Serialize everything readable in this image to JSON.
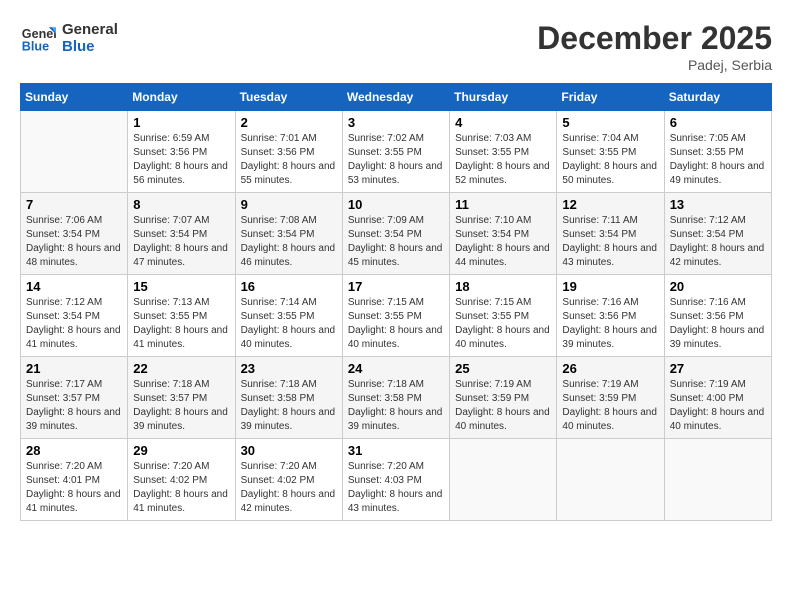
{
  "header": {
    "logo_line1": "General",
    "logo_line2": "Blue",
    "month": "December 2025",
    "location": "Padej, Serbia"
  },
  "weekdays": [
    "Sunday",
    "Monday",
    "Tuesday",
    "Wednesday",
    "Thursday",
    "Friday",
    "Saturday"
  ],
  "weeks": [
    [
      {
        "day": "",
        "sunrise": "",
        "sunset": "",
        "daylight": ""
      },
      {
        "day": "1",
        "sunrise": "Sunrise: 6:59 AM",
        "sunset": "Sunset: 3:56 PM",
        "daylight": "Daylight: 8 hours and 56 minutes."
      },
      {
        "day": "2",
        "sunrise": "Sunrise: 7:01 AM",
        "sunset": "Sunset: 3:56 PM",
        "daylight": "Daylight: 8 hours and 55 minutes."
      },
      {
        "day": "3",
        "sunrise": "Sunrise: 7:02 AM",
        "sunset": "Sunset: 3:55 PM",
        "daylight": "Daylight: 8 hours and 53 minutes."
      },
      {
        "day": "4",
        "sunrise": "Sunrise: 7:03 AM",
        "sunset": "Sunset: 3:55 PM",
        "daylight": "Daylight: 8 hours and 52 minutes."
      },
      {
        "day": "5",
        "sunrise": "Sunrise: 7:04 AM",
        "sunset": "Sunset: 3:55 PM",
        "daylight": "Daylight: 8 hours and 50 minutes."
      },
      {
        "day": "6",
        "sunrise": "Sunrise: 7:05 AM",
        "sunset": "Sunset: 3:55 PM",
        "daylight": "Daylight: 8 hours and 49 minutes."
      }
    ],
    [
      {
        "day": "7",
        "sunrise": "Sunrise: 7:06 AM",
        "sunset": "Sunset: 3:54 PM",
        "daylight": "Daylight: 8 hours and 48 minutes."
      },
      {
        "day": "8",
        "sunrise": "Sunrise: 7:07 AM",
        "sunset": "Sunset: 3:54 PM",
        "daylight": "Daylight: 8 hours and 47 minutes."
      },
      {
        "day": "9",
        "sunrise": "Sunrise: 7:08 AM",
        "sunset": "Sunset: 3:54 PM",
        "daylight": "Daylight: 8 hours and 46 minutes."
      },
      {
        "day": "10",
        "sunrise": "Sunrise: 7:09 AM",
        "sunset": "Sunset: 3:54 PM",
        "daylight": "Daylight: 8 hours and 45 minutes."
      },
      {
        "day": "11",
        "sunrise": "Sunrise: 7:10 AM",
        "sunset": "Sunset: 3:54 PM",
        "daylight": "Daylight: 8 hours and 44 minutes."
      },
      {
        "day": "12",
        "sunrise": "Sunrise: 7:11 AM",
        "sunset": "Sunset: 3:54 PM",
        "daylight": "Daylight: 8 hours and 43 minutes."
      },
      {
        "day": "13",
        "sunrise": "Sunrise: 7:12 AM",
        "sunset": "Sunset: 3:54 PM",
        "daylight": "Daylight: 8 hours and 42 minutes."
      }
    ],
    [
      {
        "day": "14",
        "sunrise": "Sunrise: 7:12 AM",
        "sunset": "Sunset: 3:54 PM",
        "daylight": "Daylight: 8 hours and 41 minutes."
      },
      {
        "day": "15",
        "sunrise": "Sunrise: 7:13 AM",
        "sunset": "Sunset: 3:55 PM",
        "daylight": "Daylight: 8 hours and 41 minutes."
      },
      {
        "day": "16",
        "sunrise": "Sunrise: 7:14 AM",
        "sunset": "Sunset: 3:55 PM",
        "daylight": "Daylight: 8 hours and 40 minutes."
      },
      {
        "day": "17",
        "sunrise": "Sunrise: 7:15 AM",
        "sunset": "Sunset: 3:55 PM",
        "daylight": "Daylight: 8 hours and 40 minutes."
      },
      {
        "day": "18",
        "sunrise": "Sunrise: 7:15 AM",
        "sunset": "Sunset: 3:55 PM",
        "daylight": "Daylight: 8 hours and 40 minutes."
      },
      {
        "day": "19",
        "sunrise": "Sunrise: 7:16 AM",
        "sunset": "Sunset: 3:56 PM",
        "daylight": "Daylight: 8 hours and 39 minutes."
      },
      {
        "day": "20",
        "sunrise": "Sunrise: 7:16 AM",
        "sunset": "Sunset: 3:56 PM",
        "daylight": "Daylight: 8 hours and 39 minutes."
      }
    ],
    [
      {
        "day": "21",
        "sunrise": "Sunrise: 7:17 AM",
        "sunset": "Sunset: 3:57 PM",
        "daylight": "Daylight: 8 hours and 39 minutes."
      },
      {
        "day": "22",
        "sunrise": "Sunrise: 7:18 AM",
        "sunset": "Sunset: 3:57 PM",
        "daylight": "Daylight: 8 hours and 39 minutes."
      },
      {
        "day": "23",
        "sunrise": "Sunrise: 7:18 AM",
        "sunset": "Sunset: 3:58 PM",
        "daylight": "Daylight: 8 hours and 39 minutes."
      },
      {
        "day": "24",
        "sunrise": "Sunrise: 7:18 AM",
        "sunset": "Sunset: 3:58 PM",
        "daylight": "Daylight: 8 hours and 39 minutes."
      },
      {
        "day": "25",
        "sunrise": "Sunrise: 7:19 AM",
        "sunset": "Sunset: 3:59 PM",
        "daylight": "Daylight: 8 hours and 40 minutes."
      },
      {
        "day": "26",
        "sunrise": "Sunrise: 7:19 AM",
        "sunset": "Sunset: 3:59 PM",
        "daylight": "Daylight: 8 hours and 40 minutes."
      },
      {
        "day": "27",
        "sunrise": "Sunrise: 7:19 AM",
        "sunset": "Sunset: 4:00 PM",
        "daylight": "Daylight: 8 hours and 40 minutes."
      }
    ],
    [
      {
        "day": "28",
        "sunrise": "Sunrise: 7:20 AM",
        "sunset": "Sunset: 4:01 PM",
        "daylight": "Daylight: 8 hours and 41 minutes."
      },
      {
        "day": "29",
        "sunrise": "Sunrise: 7:20 AM",
        "sunset": "Sunset: 4:02 PM",
        "daylight": "Daylight: 8 hours and 41 minutes."
      },
      {
        "day": "30",
        "sunrise": "Sunrise: 7:20 AM",
        "sunset": "Sunset: 4:02 PM",
        "daylight": "Daylight: 8 hours and 42 minutes."
      },
      {
        "day": "31",
        "sunrise": "Sunrise: 7:20 AM",
        "sunset": "Sunset: 4:03 PM",
        "daylight": "Daylight: 8 hours and 43 minutes."
      },
      {
        "day": "",
        "sunrise": "",
        "sunset": "",
        "daylight": ""
      },
      {
        "day": "",
        "sunrise": "",
        "sunset": "",
        "daylight": ""
      },
      {
        "day": "",
        "sunrise": "",
        "sunset": "",
        "daylight": ""
      }
    ]
  ]
}
